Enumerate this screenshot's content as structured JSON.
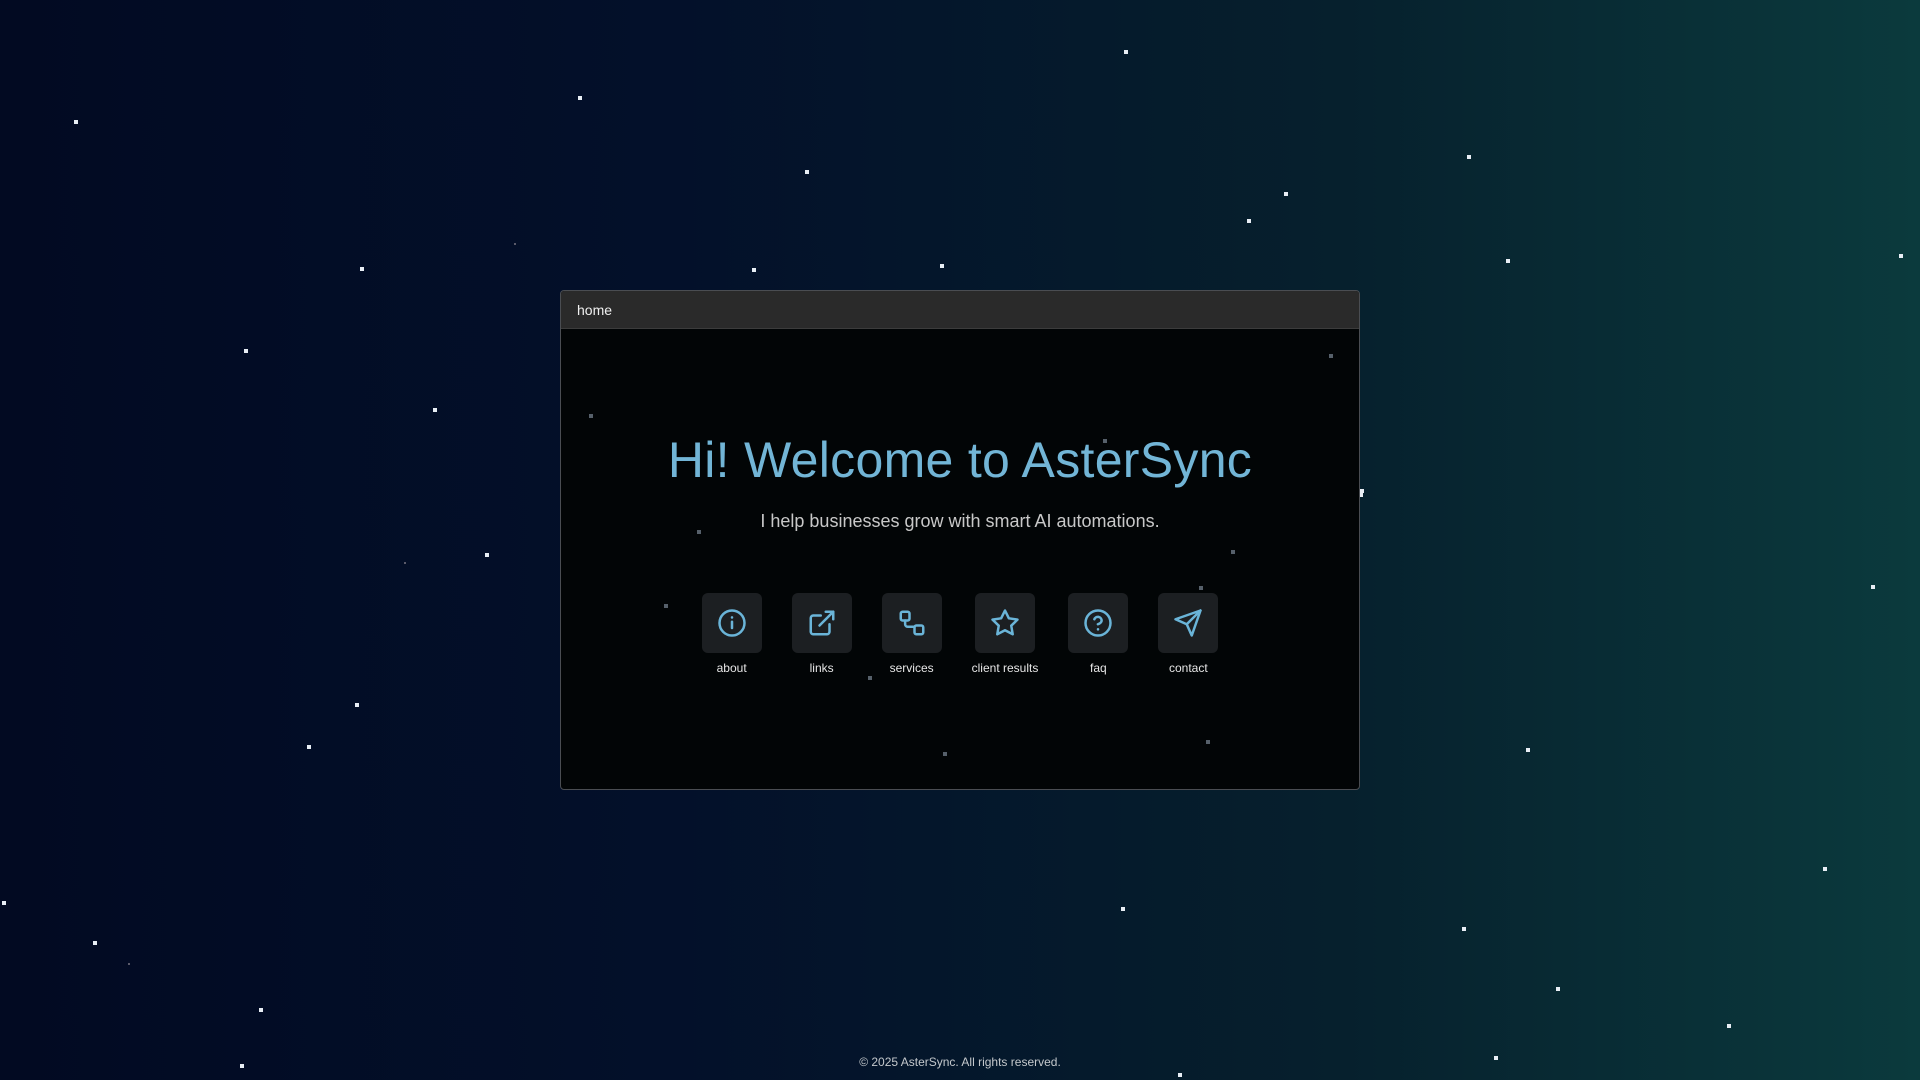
{
  "window": {
    "title": "home"
  },
  "hero": {
    "headline": "Hi! Welcome to AsterSync",
    "subtitle": "I help businesses grow with smart AI automations."
  },
  "nav": [
    {
      "label": "about",
      "icon": "info-icon"
    },
    {
      "label": "links",
      "icon": "external-link-icon"
    },
    {
      "label": "services",
      "icon": "workflow-icon"
    },
    {
      "label": "client results",
      "icon": "star-icon"
    },
    {
      "label": "faq",
      "icon": "help-circle-icon"
    },
    {
      "label": "contact",
      "icon": "send-icon"
    }
  ],
  "footer": {
    "text": "© 2025 AsterSync. All rights reserved."
  },
  "colors": {
    "accent": "#72b5d6",
    "window_bg": "#020506",
    "titlebar_bg": "#2a2a2a"
  }
}
